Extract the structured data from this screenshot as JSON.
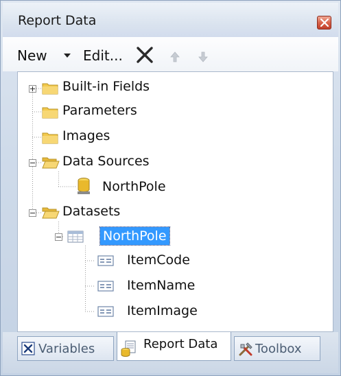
{
  "window": {
    "title": "Report Data"
  },
  "toolbar": {
    "new_label": "New",
    "edit_label": "Edit..."
  },
  "tree": {
    "built_in_fields": "Built-in Fields",
    "parameters": "Parameters",
    "images": "Images",
    "data_sources": "Data Sources",
    "data_source_northpole": "NorthPole",
    "datasets": "Datasets",
    "dataset_northpole": "NorthPole",
    "fields": [
      "ItemCode",
      "ItemName",
      "ItemImage"
    ]
  },
  "tabs": {
    "variables": "Variables",
    "report_data": "Report Data",
    "toolbox": "Toolbox"
  },
  "colors": {
    "selection": "#3399ff",
    "folder": "#f2c94c",
    "accent_close": "#c1402a"
  }
}
